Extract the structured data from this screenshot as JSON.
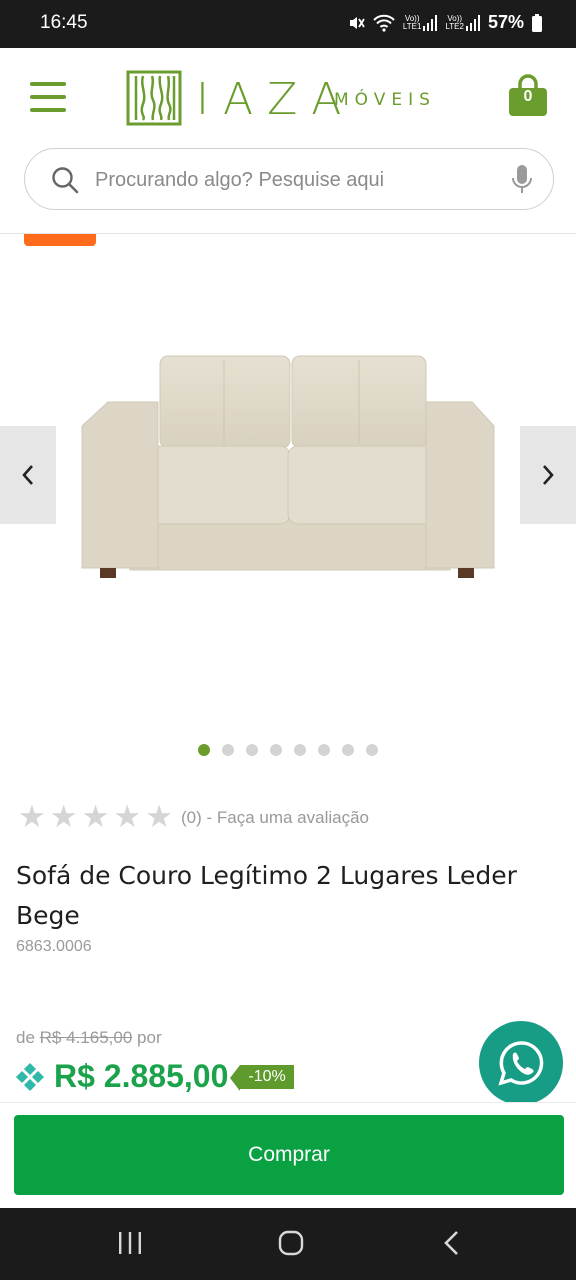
{
  "status_bar": {
    "time": "16:45",
    "battery": "57%",
    "sim1": "LTE1",
    "sim2": "LTE2"
  },
  "header": {
    "logo_name": "IAZA",
    "logo_sub": "MÓVEIS",
    "cart_count": "0",
    "search_placeholder": "Procurando algo? Pesquise aqui"
  },
  "carousel": {
    "image_count": 8,
    "active_index": 0
  },
  "product": {
    "rating_stars": 0,
    "rating_text": "(0) - Faça uma avaliação",
    "title": "Sofá de Couro Legítimo 2 Lugares Leder Bege",
    "sku": "6863.0006",
    "old_price_prefix": "de",
    "old_price": "R$ 4.165,00",
    "old_price_suffix": "por",
    "price": "R$ 2.885,00",
    "discount": "-10%"
  },
  "buy_bar": {
    "buy_label": "Comprar"
  },
  "colors": {
    "brand_green": "#6a9c2e",
    "price_green": "#1aa34a",
    "buy_green": "#0aa142",
    "whatsapp": "#179c85",
    "promo_orange": "#ff6b1a"
  }
}
